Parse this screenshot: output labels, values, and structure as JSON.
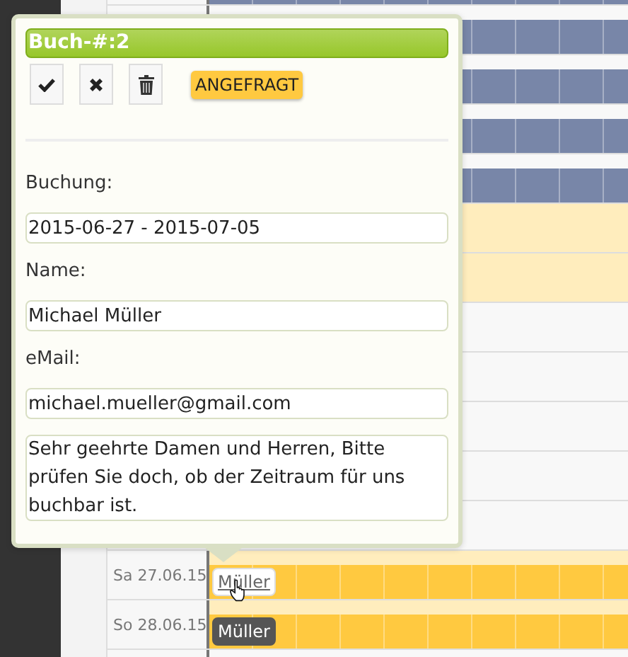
{
  "calendar": {
    "rows": [
      {
        "kind": "booked"
      },
      {
        "kind": "booked"
      },
      {
        "kind": "booked"
      },
      {
        "kind": "booked"
      },
      {
        "kind": "booked"
      },
      {
        "kind": "shaded"
      },
      {
        "kind": "shaded"
      },
      {
        "kind": "free"
      },
      {
        "kind": "free"
      },
      {
        "kind": "free"
      },
      {
        "kind": "free"
      },
      {
        "kind": "free"
      },
      {
        "kind": "requested",
        "date": "Sa 27.06.15",
        "booking": {
          "label": "Müller",
          "highlighted": true
        }
      },
      {
        "kind": "requested",
        "date": "So 28.06.15",
        "booking": {
          "label": "Müller",
          "highlighted": false
        }
      },
      {
        "kind": "free"
      }
    ]
  },
  "popover": {
    "title": "Buch-#:2",
    "actions": [
      {
        "kind": "confirm"
      },
      {
        "kind": "reject"
      },
      {
        "kind": "delete"
      }
    ],
    "status": "ANGEFRAGT",
    "fields": [
      {
        "label": "Buchung:",
        "value": "2015-06-27 - 2015-07-05"
      },
      {
        "label": "Name:",
        "value": "Michael Müller"
      },
      {
        "label": "eMail:",
        "value": "michael.mueller@gmail.com"
      }
    ],
    "message": "Sehr geehrte Damen und Herren, Bitte prüfen Sie doch, ob der Zeitraum für uns buchbar ist."
  }
}
